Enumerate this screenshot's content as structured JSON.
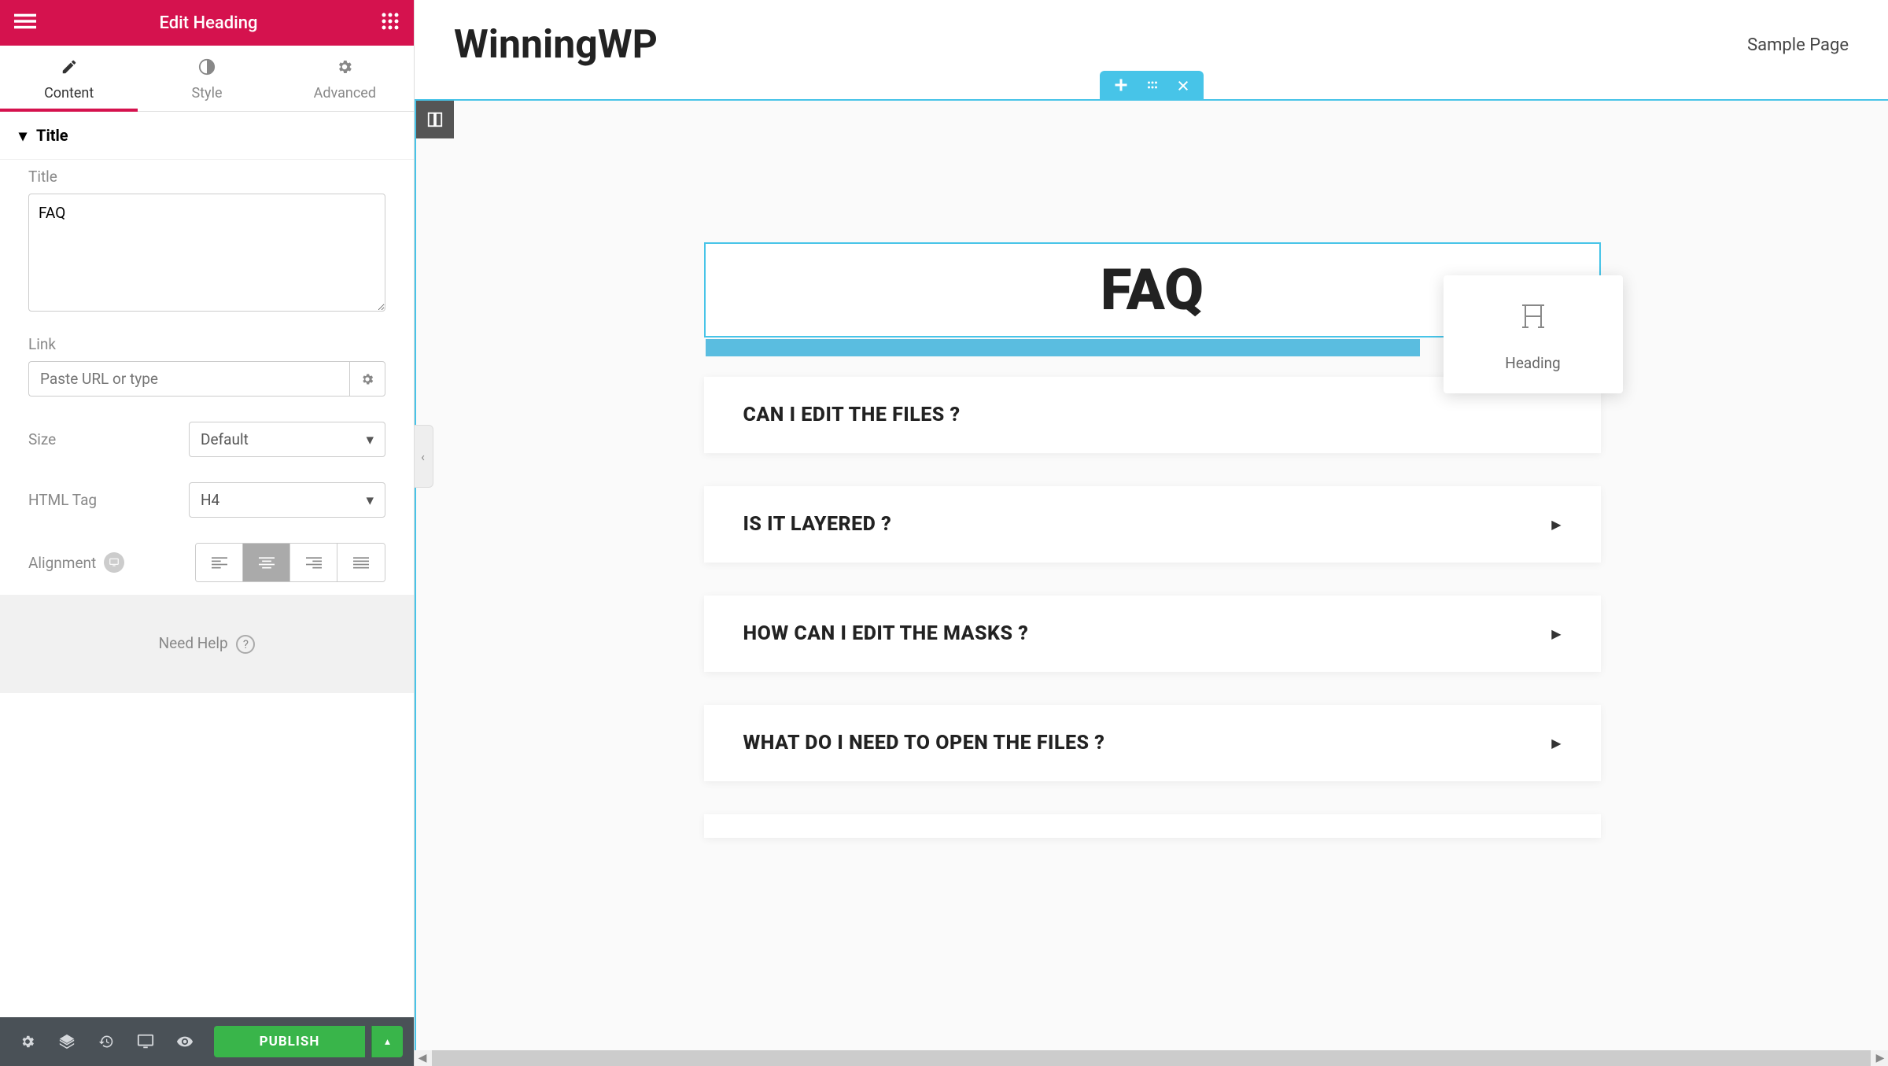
{
  "sidebar": {
    "title": "Edit Heading",
    "tabs": {
      "content": "Content",
      "style": "Style",
      "advanced": "Advanced"
    },
    "section": {
      "title": "Title"
    },
    "controls": {
      "title_label": "Title",
      "title_value": "FAQ",
      "link_label": "Link",
      "link_placeholder": "Paste URL or type",
      "link_value": "",
      "size_label": "Size",
      "size_value": "Default",
      "htmltag_label": "HTML Tag",
      "htmltag_value": "H4",
      "alignment_label": "Alignment"
    },
    "help": "Need Help",
    "publish": "PUBLISH"
  },
  "preview": {
    "site_title": "WinningWP",
    "nav_link": "Sample Page",
    "heading_text": "FAQ",
    "drag_widget_label": "Heading",
    "accordion": [
      "CAN I EDIT THE FILES ?",
      "IS IT LAYERED ?",
      "HOW CAN I EDIT THE MASKS ?",
      "WHAT DO I NEED TO OPEN THE FILES ?"
    ]
  },
  "colors": {
    "primary": "#d5124e",
    "accent": "#47c4e8",
    "success": "#39b54a"
  }
}
